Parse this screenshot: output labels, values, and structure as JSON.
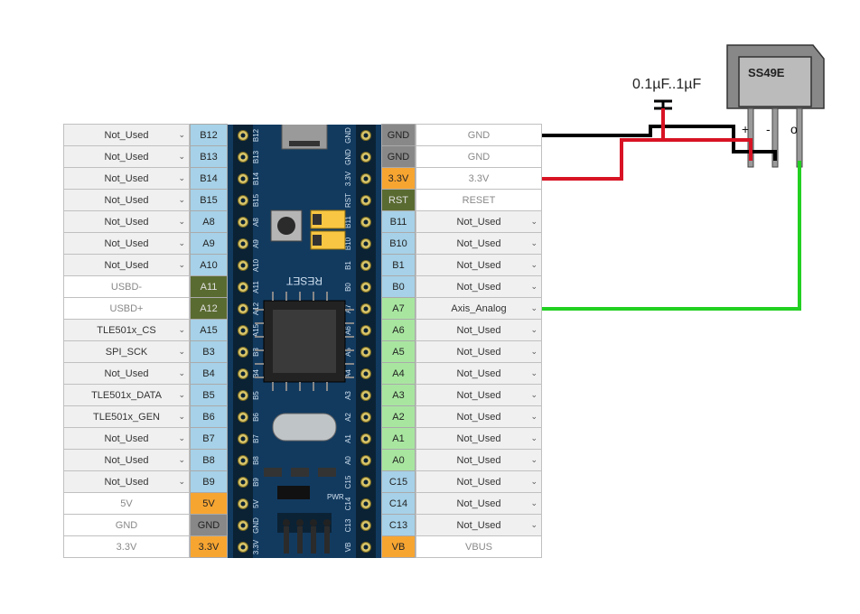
{
  "left_pins": [
    {
      "label": "B12",
      "func": "Not_Used",
      "type": "dropdown",
      "pinClass": ""
    },
    {
      "label": "B13",
      "func": "Not_Used",
      "type": "dropdown",
      "pinClass": ""
    },
    {
      "label": "B14",
      "func": "Not_Used",
      "type": "dropdown",
      "pinClass": ""
    },
    {
      "label": "B15",
      "func": "Not_Used",
      "type": "dropdown",
      "pinClass": ""
    },
    {
      "label": "A8",
      "func": "Not_Used",
      "type": "dropdown",
      "pinClass": ""
    },
    {
      "label": "A9",
      "func": "Not_Used",
      "type": "dropdown",
      "pinClass": ""
    },
    {
      "label": "A10",
      "func": "Not_Used",
      "type": "dropdown",
      "pinClass": ""
    },
    {
      "label": "A11",
      "func": "USBD-",
      "type": "static",
      "pinClass": "pl-usb"
    },
    {
      "label": "A12",
      "func": "USBD+",
      "type": "static",
      "pinClass": "pl-usb"
    },
    {
      "label": "A15",
      "func": "TLE501x_CS",
      "type": "dropdown",
      "pinClass": ""
    },
    {
      "label": "B3",
      "func": "SPI_SCK",
      "type": "dropdown",
      "pinClass": ""
    },
    {
      "label": "B4",
      "func": "Not_Used",
      "type": "dropdown",
      "pinClass": ""
    },
    {
      "label": "B5",
      "func": "TLE501x_DATA",
      "type": "dropdown",
      "pinClass": ""
    },
    {
      "label": "B6",
      "func": "TLE501x_GEN",
      "type": "dropdown",
      "pinClass": ""
    },
    {
      "label": "B7",
      "func": "Not_Used",
      "type": "dropdown",
      "pinClass": ""
    },
    {
      "label": "B8",
      "func": "Not_Used",
      "type": "dropdown",
      "pinClass": ""
    },
    {
      "label": "B9",
      "func": "Not_Used",
      "type": "dropdown",
      "pinClass": ""
    },
    {
      "label": "5V",
      "func": "5V",
      "type": "static",
      "pinClass": "pl-5v"
    },
    {
      "label": "GND",
      "func": "GND",
      "type": "static",
      "pinClass": "pl-gnd"
    },
    {
      "label": "3.3V",
      "func": "3.3V",
      "type": "static",
      "pinClass": "pl-33v"
    }
  ],
  "right_pins": [
    {
      "label": "GND",
      "func": "GND",
      "type": "static",
      "pinClass": "pl-gnd"
    },
    {
      "label": "GND",
      "func": "GND",
      "type": "static",
      "pinClass": "pl-gnd"
    },
    {
      "label": "3.3V",
      "func": "3.3V",
      "type": "static",
      "pinClass": "pl-33v"
    },
    {
      "label": "RST",
      "func": "RESET",
      "type": "static",
      "pinClass": "pl-rst"
    },
    {
      "label": "B11",
      "func": "Not_Used",
      "type": "dropdown",
      "pinClass": ""
    },
    {
      "label": "B10",
      "func": "Not_Used",
      "type": "dropdown",
      "pinClass": ""
    },
    {
      "label": "B1",
      "func": "Not_Used",
      "type": "dropdown",
      "pinClass": ""
    },
    {
      "label": "B0",
      "func": "Not_Used",
      "type": "dropdown",
      "pinClass": ""
    },
    {
      "label": "A7",
      "func": "Axis_Analog",
      "type": "dropdown",
      "pinClass": "pl-analog"
    },
    {
      "label": "A6",
      "func": "Not_Used",
      "type": "dropdown",
      "pinClass": "pl-analog"
    },
    {
      "label": "A5",
      "func": "Not_Used",
      "type": "dropdown",
      "pinClass": "pl-analog"
    },
    {
      "label": "A4",
      "func": "Not_Used",
      "type": "dropdown",
      "pinClass": "pl-analog"
    },
    {
      "label": "A3",
      "func": "Not_Used",
      "type": "dropdown",
      "pinClass": "pl-analog"
    },
    {
      "label": "A2",
      "func": "Not_Used",
      "type": "dropdown",
      "pinClass": "pl-analog"
    },
    {
      "label": "A1",
      "func": "Not_Used",
      "type": "dropdown",
      "pinClass": "pl-analog"
    },
    {
      "label": "A0",
      "func": "Not_Used",
      "type": "dropdown",
      "pinClass": "pl-analog"
    },
    {
      "label": "C15",
      "func": "Not_Used",
      "type": "dropdown",
      "pinClass": ""
    },
    {
      "label": "C14",
      "func": "Not_Used",
      "type": "dropdown",
      "pinClass": ""
    },
    {
      "label": "C13",
      "func": "Not_Used",
      "type": "dropdown",
      "pinClass": ""
    },
    {
      "label": "VB",
      "func": "VBUS",
      "type": "static",
      "pinClass": "pl-vb"
    }
  ],
  "board": {
    "silkscreen_left": "B12B13B14B15A8A9A10A11A12A15B3B4B5B6B7B8B9 5V G 3.3",
    "silkscreen_right": "G G 3.3 R B11B10B1 B0 A7 A6 A5 A4 A3 A2 A1 A0C15C14C13VB",
    "reset_text": "RESET"
  },
  "sensor": {
    "part_number": "SS49E",
    "pin1_sign": "+",
    "pin2_sign": "-",
    "pin3_sign": "o"
  },
  "capacitor_label": "0.1µF..1µF",
  "wires": {
    "gnd_color": "#000000",
    "vcc_color": "#d81324",
    "signal_color": "#22d022"
  }
}
